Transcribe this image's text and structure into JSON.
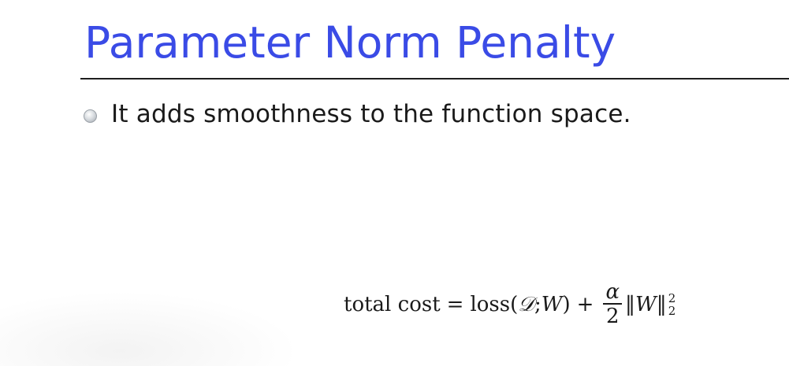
{
  "slide": {
    "title": "Parameter Norm Penalty",
    "bullets": [
      {
        "text": "It adds smoothness to the function space."
      }
    ],
    "formula": {
      "lhs": "total cost",
      "equals": "=",
      "loss_fn": "loss(",
      "dataset_symbol": "𝒟",
      "separator": ";",
      "weight_symbol": "W",
      "close_paren": ")",
      "plus": "+",
      "fraction_numerator": "α",
      "fraction_denominator": "2",
      "norm_open": "‖",
      "norm_var": "W",
      "norm_close": "‖",
      "norm_power": "2",
      "norm_subscript": "2"
    }
  }
}
